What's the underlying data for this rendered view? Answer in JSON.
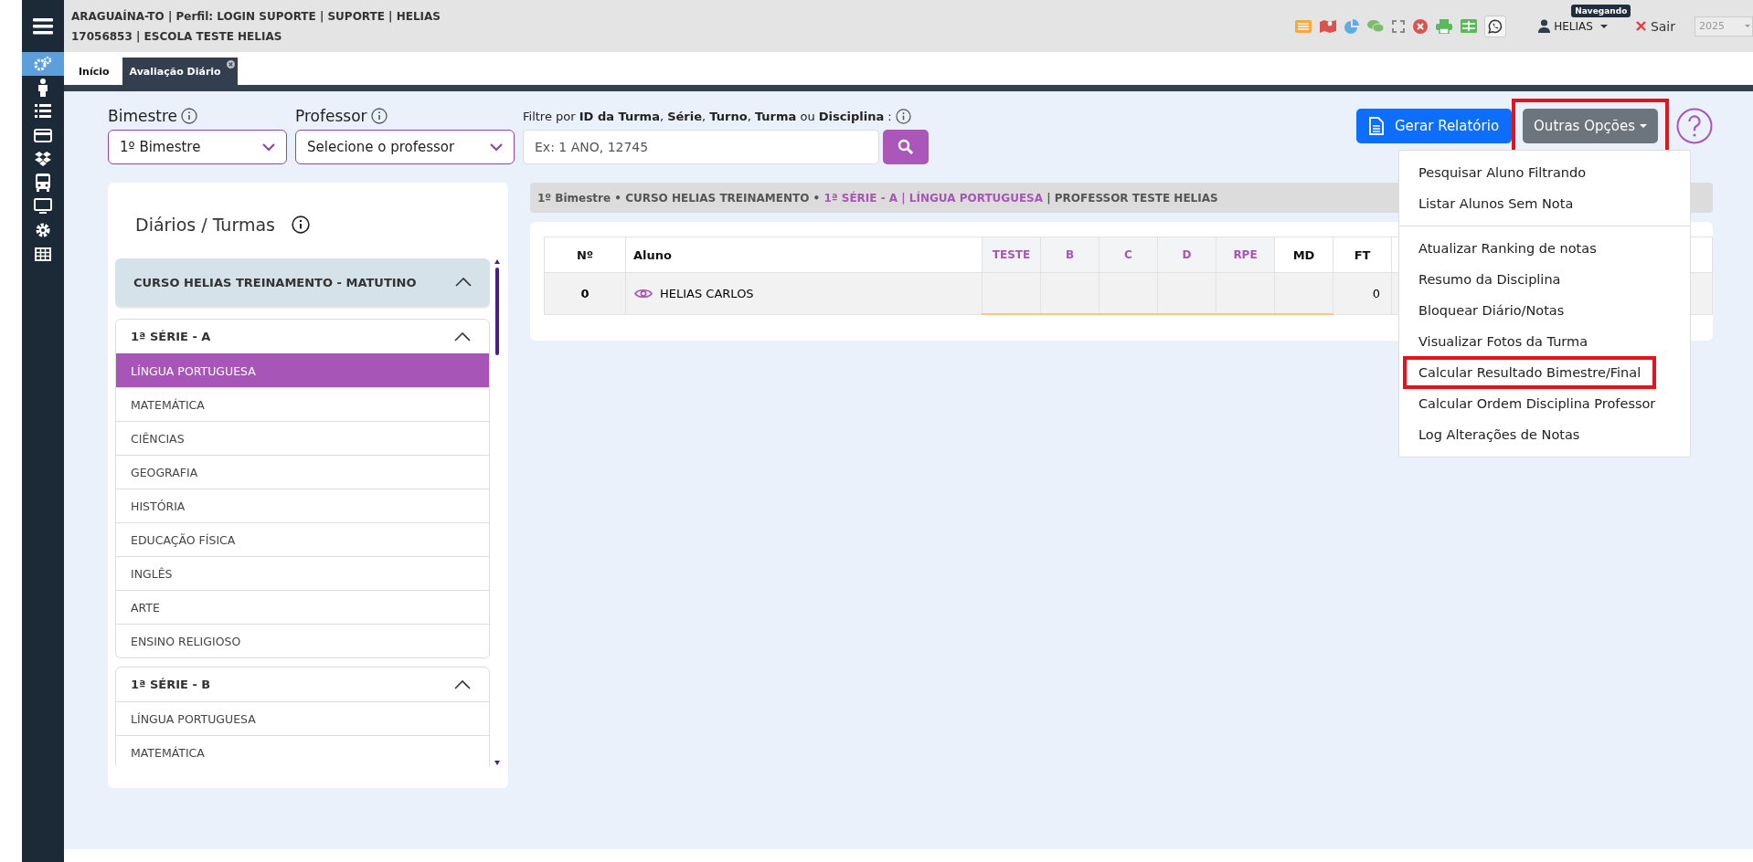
{
  "sidebar": {
    "items": [
      {
        "kind": "menu",
        "selected": false
      },
      {
        "kind": "gears",
        "selected": true
      },
      {
        "kind": "person",
        "selected": false
      },
      {
        "kind": "list",
        "selected": false
      },
      {
        "kind": "card",
        "selected": false
      },
      {
        "kind": "boxes",
        "selected": false
      },
      {
        "kind": "bus",
        "selected": false
      },
      {
        "kind": "monitor",
        "selected": false
      },
      {
        "kind": "gear",
        "selected": false
      },
      {
        "kind": "grid",
        "selected": false
      }
    ]
  },
  "header": {
    "lines": [
      "ARAGUAÍNA-TO | Perfil: LOGIN SUPORTE | SUPORTE | HELIAS",
      "17056853 | ESCOLA TESTE HELIAS"
    ],
    "toolbar": [
      {
        "kind": "list"
      },
      {
        "kind": "map"
      },
      {
        "kind": "pie"
      },
      {
        "kind": "chat"
      },
      {
        "kind": "expand"
      },
      {
        "kind": "close"
      },
      {
        "kind": "print"
      },
      {
        "kind": "table"
      },
      {
        "kind": "whatsapp"
      }
    ],
    "user": "HELIAS",
    "status_badge": "Navegando",
    "logout": "Sair",
    "year": {
      "value": "2025",
      "disabled": true
    }
  },
  "tabs": [
    {
      "label": "Início",
      "selected": false,
      "closable": false
    },
    {
      "label": "Avaliação Diário",
      "selected": true,
      "closable": true
    }
  ],
  "filters": {
    "bimestre": {
      "label": "Bimestre",
      "value": "1º Bimestre"
    },
    "professor": {
      "label": "Professor",
      "value": "Selecione o professor"
    },
    "search": {
      "label": "Filtre por **ID da Turma**, **Série**, **Turno**, **Turma** ou **Disciplina** :",
      "placeholder": "Ex: 1 ANO, 12745"
    }
  },
  "actions": {
    "report_button": "Gerar Relatório",
    "options_button": {
      "label": "Outras Opções",
      "highlighted": true
    }
  },
  "options_menu": {
    "groups": [
      [
        {
          "label": "Pesquisar Aluno Filtrando",
          "highlighted": false
        },
        {
          "label": "Listar Alunos Sem Nota",
          "highlighted": false
        }
      ],
      [
        {
          "label": "Atualizar Ranking de notas",
          "highlighted": false
        },
        {
          "label": "Resumo da Disciplina",
          "highlighted": false
        },
        {
          "label": "Bloquear Diário/Notas",
          "highlighted": false
        },
        {
          "label": "Visualizar Fotos da Turma",
          "highlighted": false
        },
        {
          "label": "Calcular Resultado Bimestre/Final",
          "highlighted": true
        },
        {
          "label": "Calcular Ordem Disciplina Professor",
          "highlighted": false
        },
        {
          "label": "Log Alterações de Notas",
          "highlighted": false
        }
      ]
    ]
  },
  "panel": {
    "title": "Diários / Turmas",
    "course": {
      "label": "CURSO HELIAS TREINAMENTO - MATUTINO",
      "expanded": true
    },
    "classes": [
      {
        "label": "1ª SÉRIE - A",
        "expanded": true,
        "subjects": [
          {
            "label": "LÍNGUA PORTUGUESA",
            "selected": true
          },
          {
            "label": "MATEMÁTICA",
            "selected": false
          },
          {
            "label": "CIÊNCIAS",
            "selected": false
          },
          {
            "label": "GEOGRAFIA",
            "selected": false
          },
          {
            "label": "HISTÓRIA",
            "selected": false
          },
          {
            "label": "EDUCAÇÃO FÍSICA",
            "selected": false
          },
          {
            "label": "INGLÊS",
            "selected": false
          },
          {
            "label": "ARTE",
            "selected": false
          },
          {
            "label": "ENSINO RELIGIOSO",
            "selected": false
          }
        ]
      },
      {
        "label": "1ª SÉRIE - B",
        "expanded": true,
        "subjects": [
          {
            "label": "LÍNGUA PORTUGUESA",
            "selected": false
          },
          {
            "label": "MATEMÁTICA",
            "selected": false
          }
        ]
      }
    ]
  },
  "breadcrumb": [
    {
      "text": "1º Bimestre • CURSO HELIAS TREINAMENTO • ",
      "kind": "plain"
    },
    {
      "text": "1ª SÉRIE - A | LÍNGUA PORTUGUESA",
      "kind": "accent"
    },
    {
      "text": " | PROFESSOR TESTE HELIAS",
      "kind": "plain"
    }
  ],
  "table": {
    "columns": [
      {
        "label": "Nº",
        "kind": "index"
      },
      {
        "label": "Aluno",
        "kind": "name"
      },
      {
        "label": "TESTE",
        "kind": "grade"
      },
      {
        "label": "B",
        "kind": "grade"
      },
      {
        "label": "C",
        "kind": "grade"
      },
      {
        "label": "D",
        "kind": "grade"
      },
      {
        "label": "RPE",
        "kind": "grade"
      },
      {
        "label": "MD",
        "kind": "summary"
      },
      {
        "label": "FT",
        "kind": "summary"
      }
    ],
    "rows": [
      {
        "cells": [
          "0",
          "HELIAS CARLOS",
          null,
          null,
          null,
          null,
          null,
          null,
          "0"
        ]
      }
    ]
  }
}
